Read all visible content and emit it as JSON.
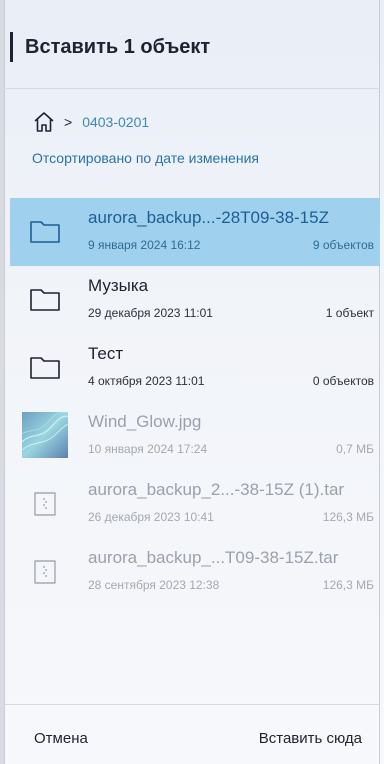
{
  "dialog": {
    "title": "Вставить 1 объект"
  },
  "breadcrumb": {
    "home_icon": "home-icon",
    "separator": ">",
    "current_folder": "0403-0201"
  },
  "sort_label": "Отсортировано по дате изменения",
  "files": [
    {
      "name": "aurora_backup...-28T09-38-15Z",
      "date": "9 января 2024 16:12",
      "info": "9 объектов",
      "type": "folder",
      "state": "selected"
    },
    {
      "name": "Музыка",
      "date": "29 декабря 2023 11:01",
      "info": "1 объект",
      "type": "folder",
      "state": "normal"
    },
    {
      "name": "Тест",
      "date": "4 октября 2023 11:01",
      "info": "0 объектов",
      "type": "folder",
      "state": "normal"
    },
    {
      "name": "Wind_Glow.jpg",
      "date": "10 января 2024 17:24",
      "info": "0,7 МБ",
      "type": "image",
      "state": "dim"
    },
    {
      "name": "aurora_backup_2...-38-15Z (1).tar",
      "date": "26 декабря 2023 10:41",
      "info": "126,3 МБ",
      "type": "archive",
      "state": "dim"
    },
    {
      "name": "aurora_backup_...T09-38-15Z.tar",
      "date": "28 сентября 2023 12:38",
      "info": "126,3 МБ",
      "type": "archive",
      "state": "dim"
    }
  ],
  "footer": {
    "cancel_label": "Отмена",
    "paste_label": "Вставить сюда"
  },
  "colors": {
    "accent": "#2a73a6",
    "selected_bg": "#9fd1ee"
  }
}
